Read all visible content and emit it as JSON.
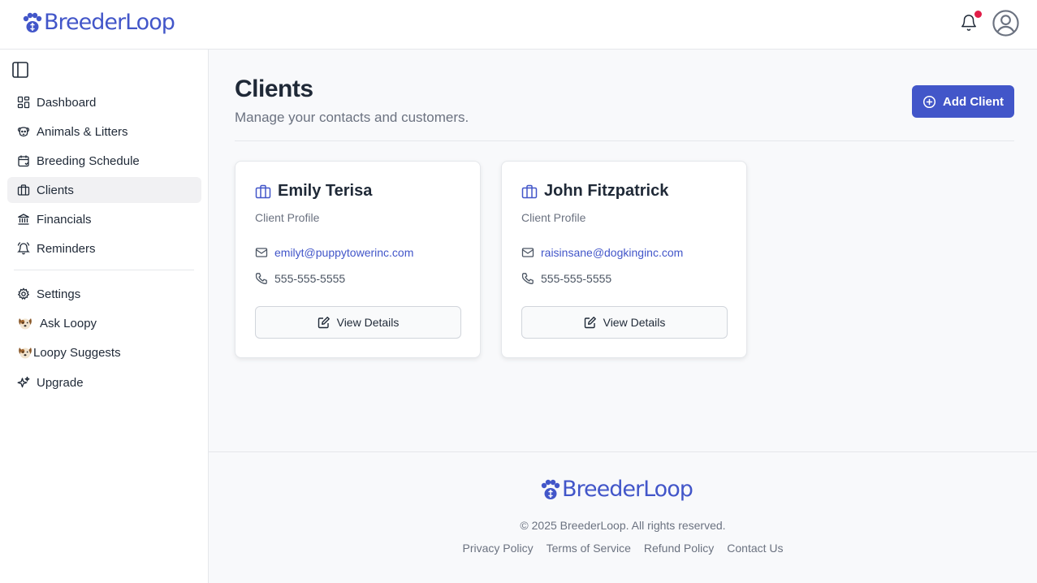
{
  "brand": {
    "name": "BreederLoop",
    "color": "#4256c9",
    "notification_dot_color": "#e11d48"
  },
  "header": {
    "icons": [
      "paw-icon",
      "bell-icon",
      "user-avatar-icon"
    ]
  },
  "sidebar": {
    "items": [
      {
        "label": "Dashboard",
        "icon": "dashboard-icon"
      },
      {
        "label": "Animals & Litters",
        "icon": "dog-face-icon"
      },
      {
        "label": "Breeding Schedule",
        "icon": "calendar-icon"
      },
      {
        "label": "Clients",
        "icon": "briefcase-icon",
        "active": true
      },
      {
        "label": "Financials",
        "icon": "bank-icon"
      },
      {
        "label": "Reminders",
        "icon": "bell-icon"
      },
      {
        "label": "Settings",
        "icon": "gear-icon"
      },
      {
        "label": "Ask Loopy",
        "icon": "dog-emoji-icon"
      },
      {
        "label": "Loopy Suggests",
        "icon": "dog-emoji-icon"
      },
      {
        "label": "Upgrade",
        "icon": "sparkles-icon"
      }
    ]
  },
  "main": {
    "title": "Clients",
    "subtitle": "Manage your contacts and customers.",
    "add_button": "Add Client"
  },
  "clients": [
    {
      "name": "Emily Terisa",
      "subtitle": "Client Profile",
      "email": "emilyt@puppytowerinc.com",
      "phone": "555-555-5555",
      "button": "View Details"
    },
    {
      "name": "John Fitzpatrick",
      "subtitle": "Client Profile",
      "email": "raisinsane@dogkinginc.com",
      "phone": "555-555-5555",
      "button": "View Details"
    }
  ],
  "footer": {
    "copyright": "© 2025 BreederLoop. All rights reserved.",
    "links": [
      "Privacy Policy",
      "Terms of Service",
      "Refund Policy",
      "Contact Us"
    ]
  }
}
